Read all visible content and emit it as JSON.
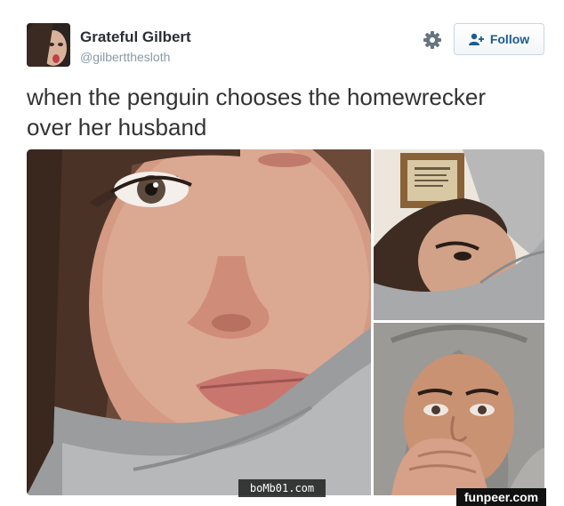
{
  "user": {
    "display_name": "Grateful Gilbert",
    "handle": "@gilbertthesloth"
  },
  "actions": {
    "follow_label": "Follow"
  },
  "tweet": {
    "text_line1": "when the penguin chooses the homewrecker",
    "text_line2": "over her husband"
  },
  "watermarks": {
    "bomb": "boMb01.com",
    "funpeer": "funpeer.com"
  },
  "colors": {
    "accent": "#1b5c90",
    "handle": "#8899a6",
    "text": "#333333"
  },
  "icons": {
    "settings": "gear-icon",
    "follow": "add-user-icon"
  }
}
